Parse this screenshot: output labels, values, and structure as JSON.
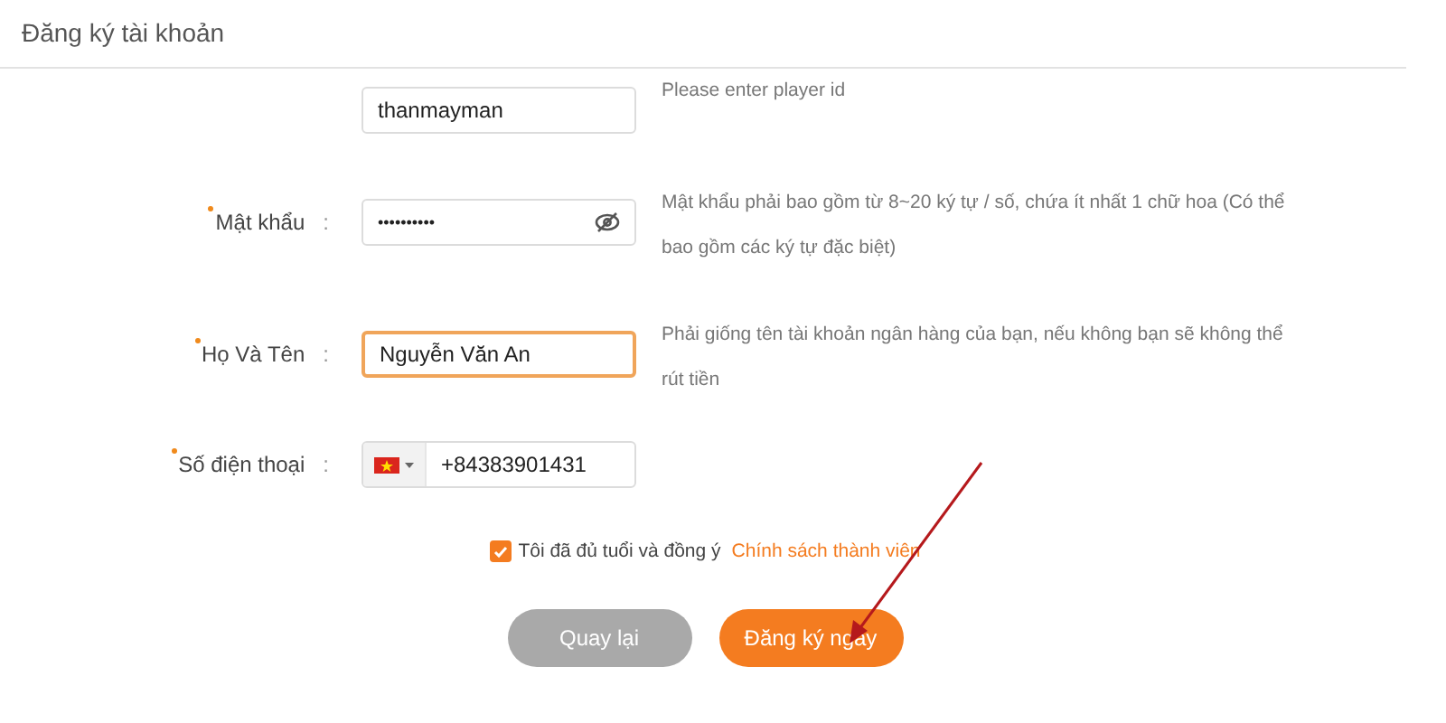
{
  "title": "Đăng ký tài khoản",
  "fields": [
    {
      "kind": "text",
      "value": "thanmayman",
      "focused": false,
      "hint": "Please enter player id"
    },
    {
      "kind": "password",
      "label": "Mật khẩu",
      "required": true,
      "value": "••••••••••",
      "focused": false,
      "hint": "Mật khẩu phải bao gồm từ 8~20 ký tự / số, chứa ít nhất 1 chữ hoa (Có thể bao gồm các ký tự đặc biệt)"
    },
    {
      "kind": "text",
      "label": "Họ Và Tên",
      "required": true,
      "value": "Nguyễn Văn An",
      "focused": true,
      "hint": "Phải giống tên tài khoản ngân hàng của bạn, nếu không bạn sẽ không thể rút tiền"
    },
    {
      "kind": "phone",
      "label": "Số điện thoại",
      "required": true,
      "value": "+84383901431",
      "focused": false
    }
  ],
  "colon": ":",
  "agreement": {
    "checked": true,
    "text": "Tôi đã đủ tuổi và đồng ý",
    "link": "Chính sách thành viên"
  },
  "buttons": [
    {
      "label": "Quay lại",
      "kind": "secondary"
    },
    {
      "label": "Đăng ký ngay",
      "kind": "primary"
    }
  ],
  "annotations": [
    {
      "kind": "arrow"
    }
  ]
}
